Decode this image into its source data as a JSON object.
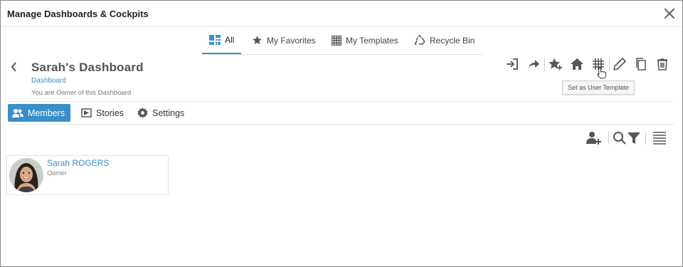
{
  "window": {
    "title": "Manage Dashboards & Cockpits"
  },
  "tabs": [
    {
      "label": "All",
      "icon": "dashboard-grid-icon",
      "active": true
    },
    {
      "label": "My Favorites",
      "icon": "star-icon"
    },
    {
      "label": "My Templates",
      "icon": "grid-template-icon"
    },
    {
      "label": "Recycle Bin",
      "icon": "recycle-icon"
    }
  ],
  "dashboard": {
    "title": "Sarah's Dashboard",
    "type": "Dashboard",
    "owner_text": "You are Owner of this Dashboard"
  },
  "toolbar": {
    "icons": [
      "sign-in-icon",
      "share-icon",
      "add-favorite-icon",
      "home-icon",
      "template-grid-icon",
      "edit-pencil-icon",
      "copy-icon",
      "trash-icon"
    ],
    "tooltip": "Set as User Template"
  },
  "subtabs": [
    {
      "label": "Members",
      "icon": "users-icon",
      "active": true
    },
    {
      "label": "Stories",
      "icon": "stories-icon"
    },
    {
      "label": "Settings",
      "icon": "gear-icon"
    }
  ],
  "members": [
    {
      "name": "Sarah ROGERS",
      "role": "Owner"
    }
  ],
  "colors": {
    "accent": "#3b8fc7",
    "icon": "#555555"
  }
}
